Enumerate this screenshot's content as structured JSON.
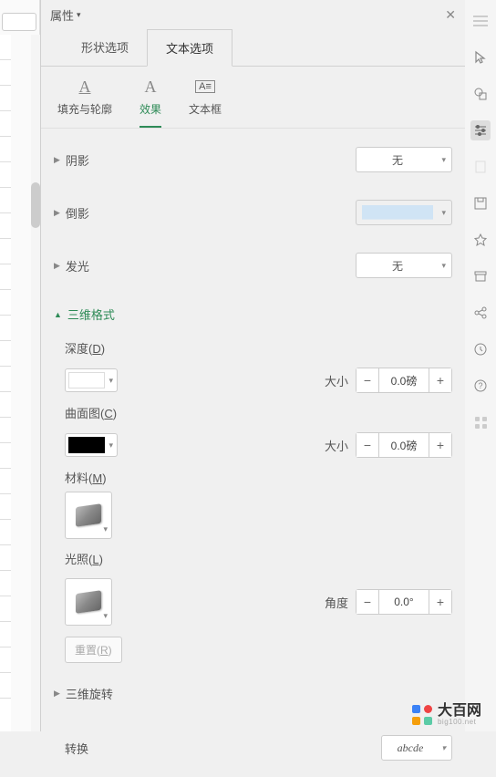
{
  "panel_title": "属性",
  "main_tabs": [
    "形状选项",
    "文本选项"
  ],
  "sub_tabs": [
    {
      "label": "填充与轮廓"
    },
    {
      "label": "效果"
    },
    {
      "label": "文本框"
    }
  ],
  "sections": {
    "shadow": {
      "title": "阴影",
      "value": "无"
    },
    "reflection": {
      "title": "倒影"
    },
    "glow": {
      "title": "发光",
      "value": "无"
    },
    "format3d": {
      "title": "三维格式",
      "depth": {
        "label": "深度(",
        "key": "D",
        "close": ")",
        "size_label": "大小",
        "size_value": "0.0磅"
      },
      "contour": {
        "label": "曲面图(",
        "key": "C",
        "close": ")",
        "size_label": "大小",
        "size_value": "0.0磅"
      },
      "material": {
        "label": "材料(",
        "key": "M",
        "close": ")"
      },
      "lighting": {
        "label": "光照(",
        "key": "L",
        "close": ")",
        "angle_label": "角度",
        "angle_value": "0.0°"
      },
      "reset": "重置(",
      "reset_key": "R",
      "reset_close": ")"
    },
    "rotate3d": {
      "title": "三维旋转"
    },
    "transform": {
      "title": "转换",
      "value": "abcde"
    }
  },
  "watermark": {
    "main": "大百网",
    "sub": "big100.net"
  }
}
